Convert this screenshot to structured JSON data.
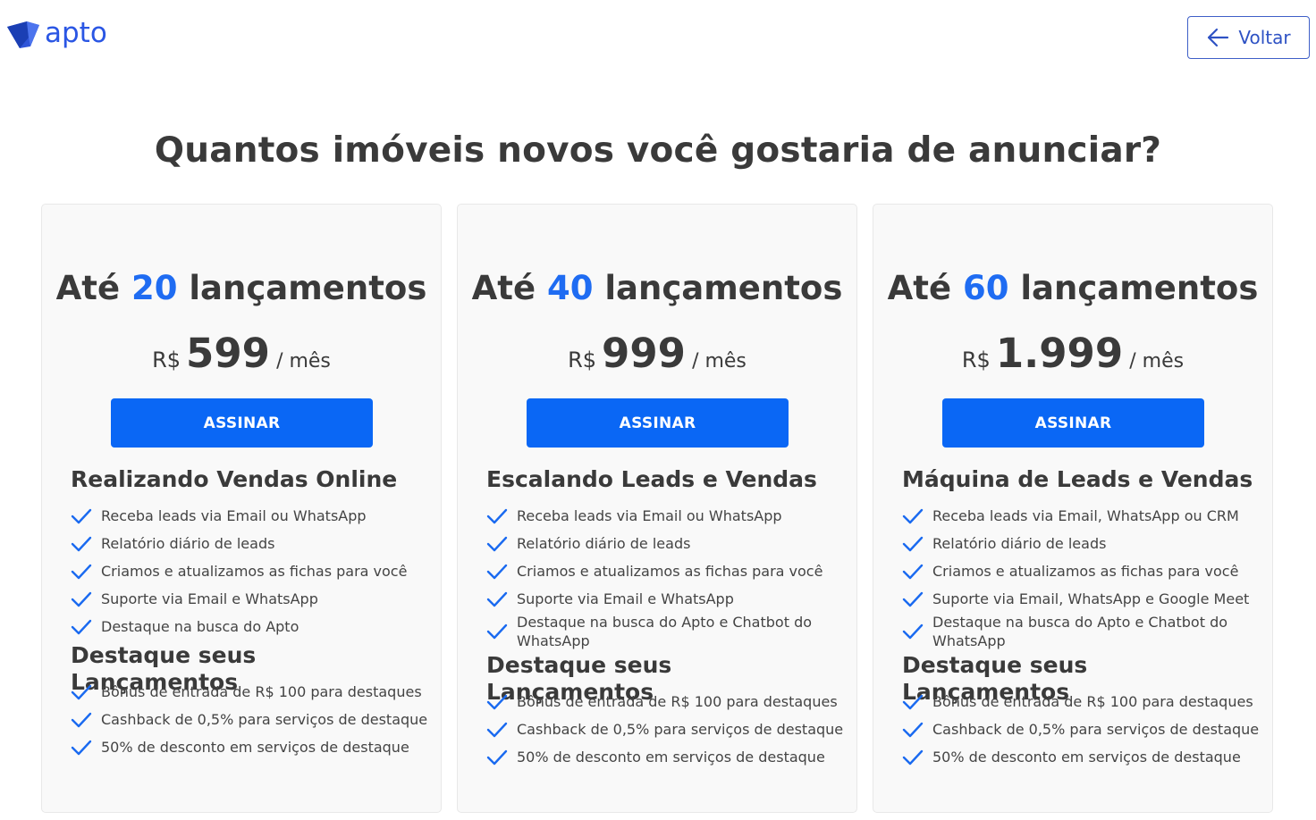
{
  "header": {
    "logo_text": "apto",
    "back_label": "Voltar",
    "brand_color": "#2a56e4"
  },
  "headline": "Quantos imóveis novos você gostaria de anunciar?",
  "plans": [
    {
      "title_prefix": "Até",
      "title_number": "20",
      "title_suffix": "lançamentos",
      "currency": "R$",
      "price": "599",
      "period": "/ mês",
      "cta": "ASSINAR",
      "section1_title": "Realizando Vendas Online",
      "section1_items": [
        "Receba leads via Email ou WhatsApp",
        "Relatório diário de leads",
        "Criamos e atualizamos as fichas para você",
        "Suporte via Email e WhatsApp",
        "Destaque na busca do Apto"
      ],
      "section2_title": "Destaque seus Lançamentos",
      "section2_items": [
        "Bônus de entrada de R$ 100 para destaques",
        "Cashback de 0,5% para serviços de destaque",
        "50% de desconto em serviços de destaque"
      ]
    },
    {
      "title_prefix": "Até",
      "title_number": "40",
      "title_suffix": "lançamentos",
      "currency": "R$",
      "price": "999",
      "period": "/ mês",
      "cta": "ASSINAR",
      "section1_title": "Escalando Leads e Vendas",
      "section1_items": [
        "Receba leads via Email ou WhatsApp",
        "Relatório diário de leads",
        "Criamos e atualizamos as fichas para você",
        "Suporte via Email e WhatsApp",
        "Destaque na busca do Apto e Chatbot do WhatsApp"
      ],
      "section2_title": "Destaque seus Lançamentos",
      "section2_items": [
        "Bônus de entrada de R$ 100 para destaques",
        "Cashback de 0,5% para serviços de destaque",
        "50% de desconto em serviços de destaque"
      ]
    },
    {
      "title_prefix": "Até",
      "title_number": "60",
      "title_suffix": "lançamentos",
      "currency": "R$",
      "price": "1.999",
      "period": "/ mês",
      "cta": "ASSINAR",
      "section1_title": "Máquina de Leads e Vendas",
      "section1_items": [
        "Receba leads via Email, WhatsApp ou CRM",
        "Relatório diário de leads",
        "Criamos e atualizamos as fichas para você",
        "Suporte via Email, WhatsApp e Google Meet",
        "Destaque na busca do Apto e Chatbot do WhatsApp"
      ],
      "section2_title": "Destaque seus Lançamentos",
      "section2_items": [
        "Bônus de entrada de R$ 100 para destaques",
        "Cashback de 0,5% para serviços de destaque",
        "50% de desconto em serviços de destaque"
      ]
    }
  ],
  "icons": {
    "logo": "apto-logo-icon",
    "back": "arrow-left-icon",
    "feature": "check-icon"
  },
  "colors": {
    "accent": "#1f6cf2",
    "button": "#0a67f5",
    "check": "#1a6af0"
  }
}
